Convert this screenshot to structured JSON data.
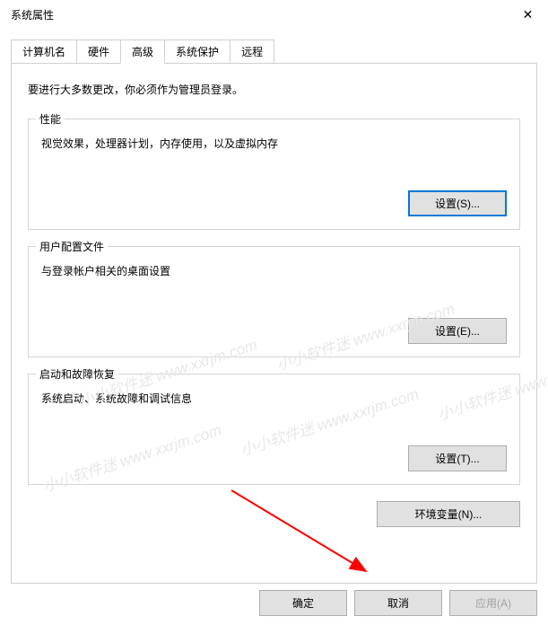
{
  "window": {
    "title": "系统属性",
    "close": "✕"
  },
  "tabs": {
    "computerName": "计算机名",
    "hardware": "硬件",
    "advanced": "高级",
    "systemProtection": "系统保护",
    "remote": "远程"
  },
  "intro": "要进行大多数更改，你必须作为管理员登录。",
  "performance": {
    "legend": "性能",
    "desc": "视觉效果，处理器计划，内存使用，以及虚拟内存",
    "button": "设置(S)..."
  },
  "userProfiles": {
    "legend": "用户配置文件",
    "desc": "与登录帐户相关的桌面设置",
    "button": "设置(E)..."
  },
  "startupRecovery": {
    "legend": "启动和故障恢复",
    "desc": "系统启动、系统故障和调试信息",
    "button": "设置(T)..."
  },
  "envVars": {
    "button": "环境变量(N)..."
  },
  "bottomButtons": {
    "ok": "确定",
    "cancel": "取消",
    "apply": "应用(A)"
  },
  "watermark": "小小软件迷 www.xxrjm.com"
}
